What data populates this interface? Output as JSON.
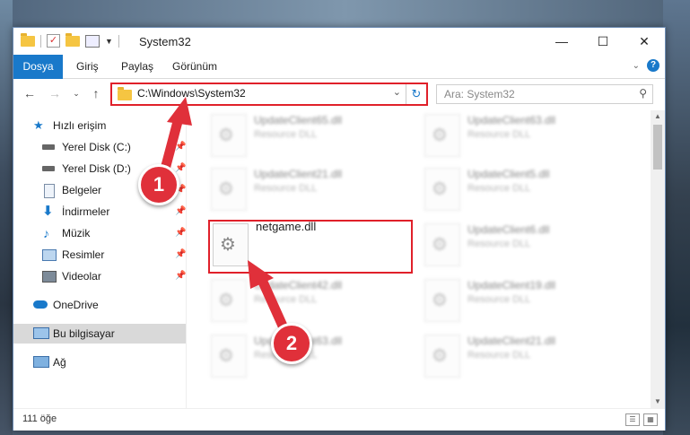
{
  "window": {
    "title": "System32"
  },
  "ribbon": {
    "tabs": [
      "Dosya",
      "Giriş",
      "Paylaş",
      "Görünüm"
    ]
  },
  "nav": {
    "address": "C:\\Windows\\System32",
    "search_placeholder": "Ara: System32"
  },
  "sidebar": {
    "items": [
      {
        "label": "Hızlı erişim",
        "icon": "star-icon"
      },
      {
        "label": "Yerel Disk (C:)",
        "icon": "drive-icon",
        "pinned": true
      },
      {
        "label": "Yerel Disk (D:)",
        "icon": "drive-icon",
        "pinned": true
      },
      {
        "label": "Belgeler",
        "icon": "document-icon",
        "pinned": true
      },
      {
        "label": "İndirmeler",
        "icon": "download-icon",
        "pinned": true
      },
      {
        "label": "Müzik",
        "icon": "music-icon",
        "pinned": true
      },
      {
        "label": "Resimler",
        "icon": "pictures-icon",
        "pinned": true
      },
      {
        "label": "Videolar",
        "icon": "video-icon",
        "pinned": true
      },
      {
        "label": "OneDrive",
        "icon": "cloud-icon"
      },
      {
        "label": "Bu bilgisayar",
        "icon": "computer-icon",
        "selected": true
      },
      {
        "label": "Ağ",
        "icon": "network-icon"
      }
    ]
  },
  "files": [
    {
      "name": "UpdateClient65.dll",
      "type": "Resource DLL"
    },
    {
      "name": "UpdateClient63.dll",
      "type": "Resource DLL"
    },
    {
      "name": "UpdateClient21.dll",
      "type": "Resource DLL"
    },
    {
      "name": "UpdateClient5.dll",
      "type": "Resource DLL"
    },
    {
      "name": "netgame.dll",
      "type": ""
    },
    {
      "name": "UpdateClient6.dll",
      "type": "Resource DLL"
    },
    {
      "name": "UpdateClient42.dll",
      "type": "Resource DLL"
    },
    {
      "name": "UpdateClient19.dll",
      "type": "Resource DLL"
    },
    {
      "name": "UpdateClient63.dll",
      "type": "Resource DLL"
    },
    {
      "name": "UpdateClient21.dll",
      "type": "Resource DLL"
    }
  ],
  "status": {
    "item_count": "111 öğe"
  },
  "annotations": {
    "step1": "1",
    "step2": "2"
  },
  "colors": {
    "accent": "#1979ca",
    "highlight": "#e0202a",
    "badge": "#e0303a"
  }
}
